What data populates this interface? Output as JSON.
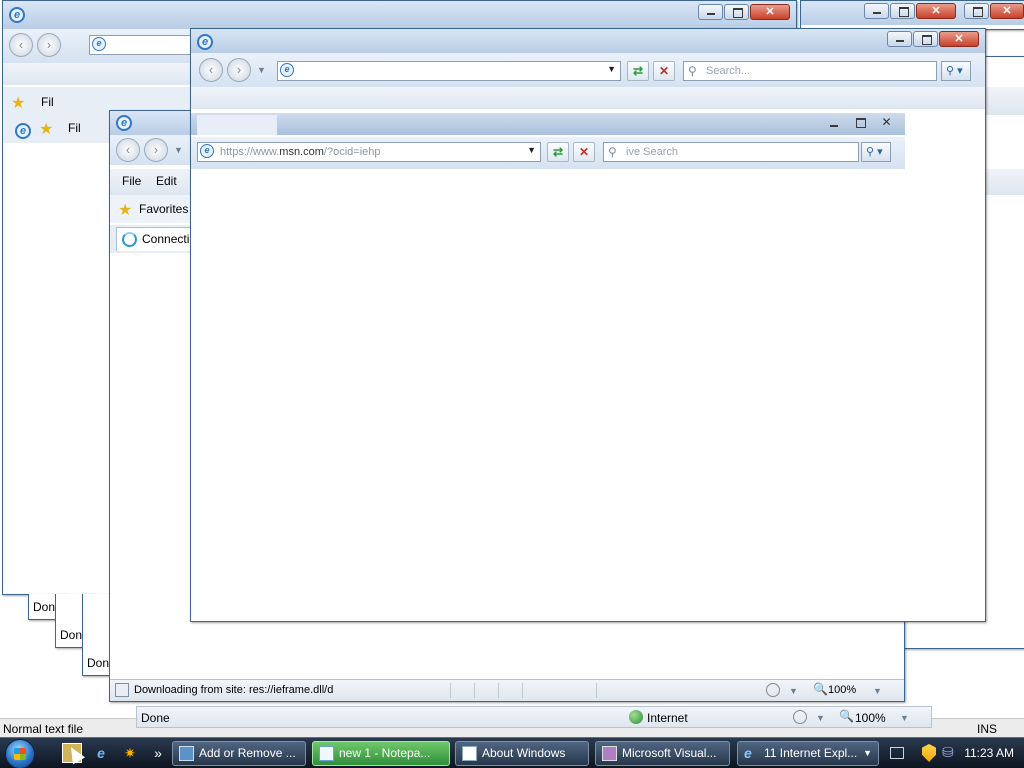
{
  "back_windows": {
    "left_menu_fragment": "Fil",
    "left_menu_fragment_2": "Fil",
    "status_done_1": "Don",
    "status_done_2": "Don",
    "status_done_3": "Don"
  },
  "notepad_status": {
    "left": "Normal text file",
    "right": "INS"
  },
  "mid_window": {
    "menu": [
      "File",
      "Edit"
    ],
    "favorites_label": "Favorites",
    "tab_label": "Connecti",
    "status_text": "Downloading from site: res://ieframe.dll/d",
    "zoom": "100%"
  },
  "main_window": {
    "search_placeholder": "Search...",
    "address_value": ""
  },
  "inner_toolbar": {
    "address_prefix": "https://www.",
    "address_domain": "msn.com",
    "address_suffix": "/?ocid=iehp",
    "search_placeholder": "ive Search"
  },
  "back_status": {
    "text": "Done",
    "zone": "Internet",
    "zoom": "100%"
  },
  "taskbar": {
    "buttons": [
      {
        "label": "Add or Remove ...",
        "active": false
      },
      {
        "label": "new 1 - Notepa...",
        "active": true
      },
      {
        "label": "About Windows",
        "active": false
      },
      {
        "label": "Microsoft Visual...",
        "active": false
      },
      {
        "label": "11 Internet Expl...",
        "active": false
      }
    ],
    "quick_launch_more": "»",
    "clock": "11:23 AM"
  },
  "colors": {
    "frame_border": "#3c6690",
    "taskbar_bg": "#1a2636",
    "active_task": "#3ea244"
  }
}
